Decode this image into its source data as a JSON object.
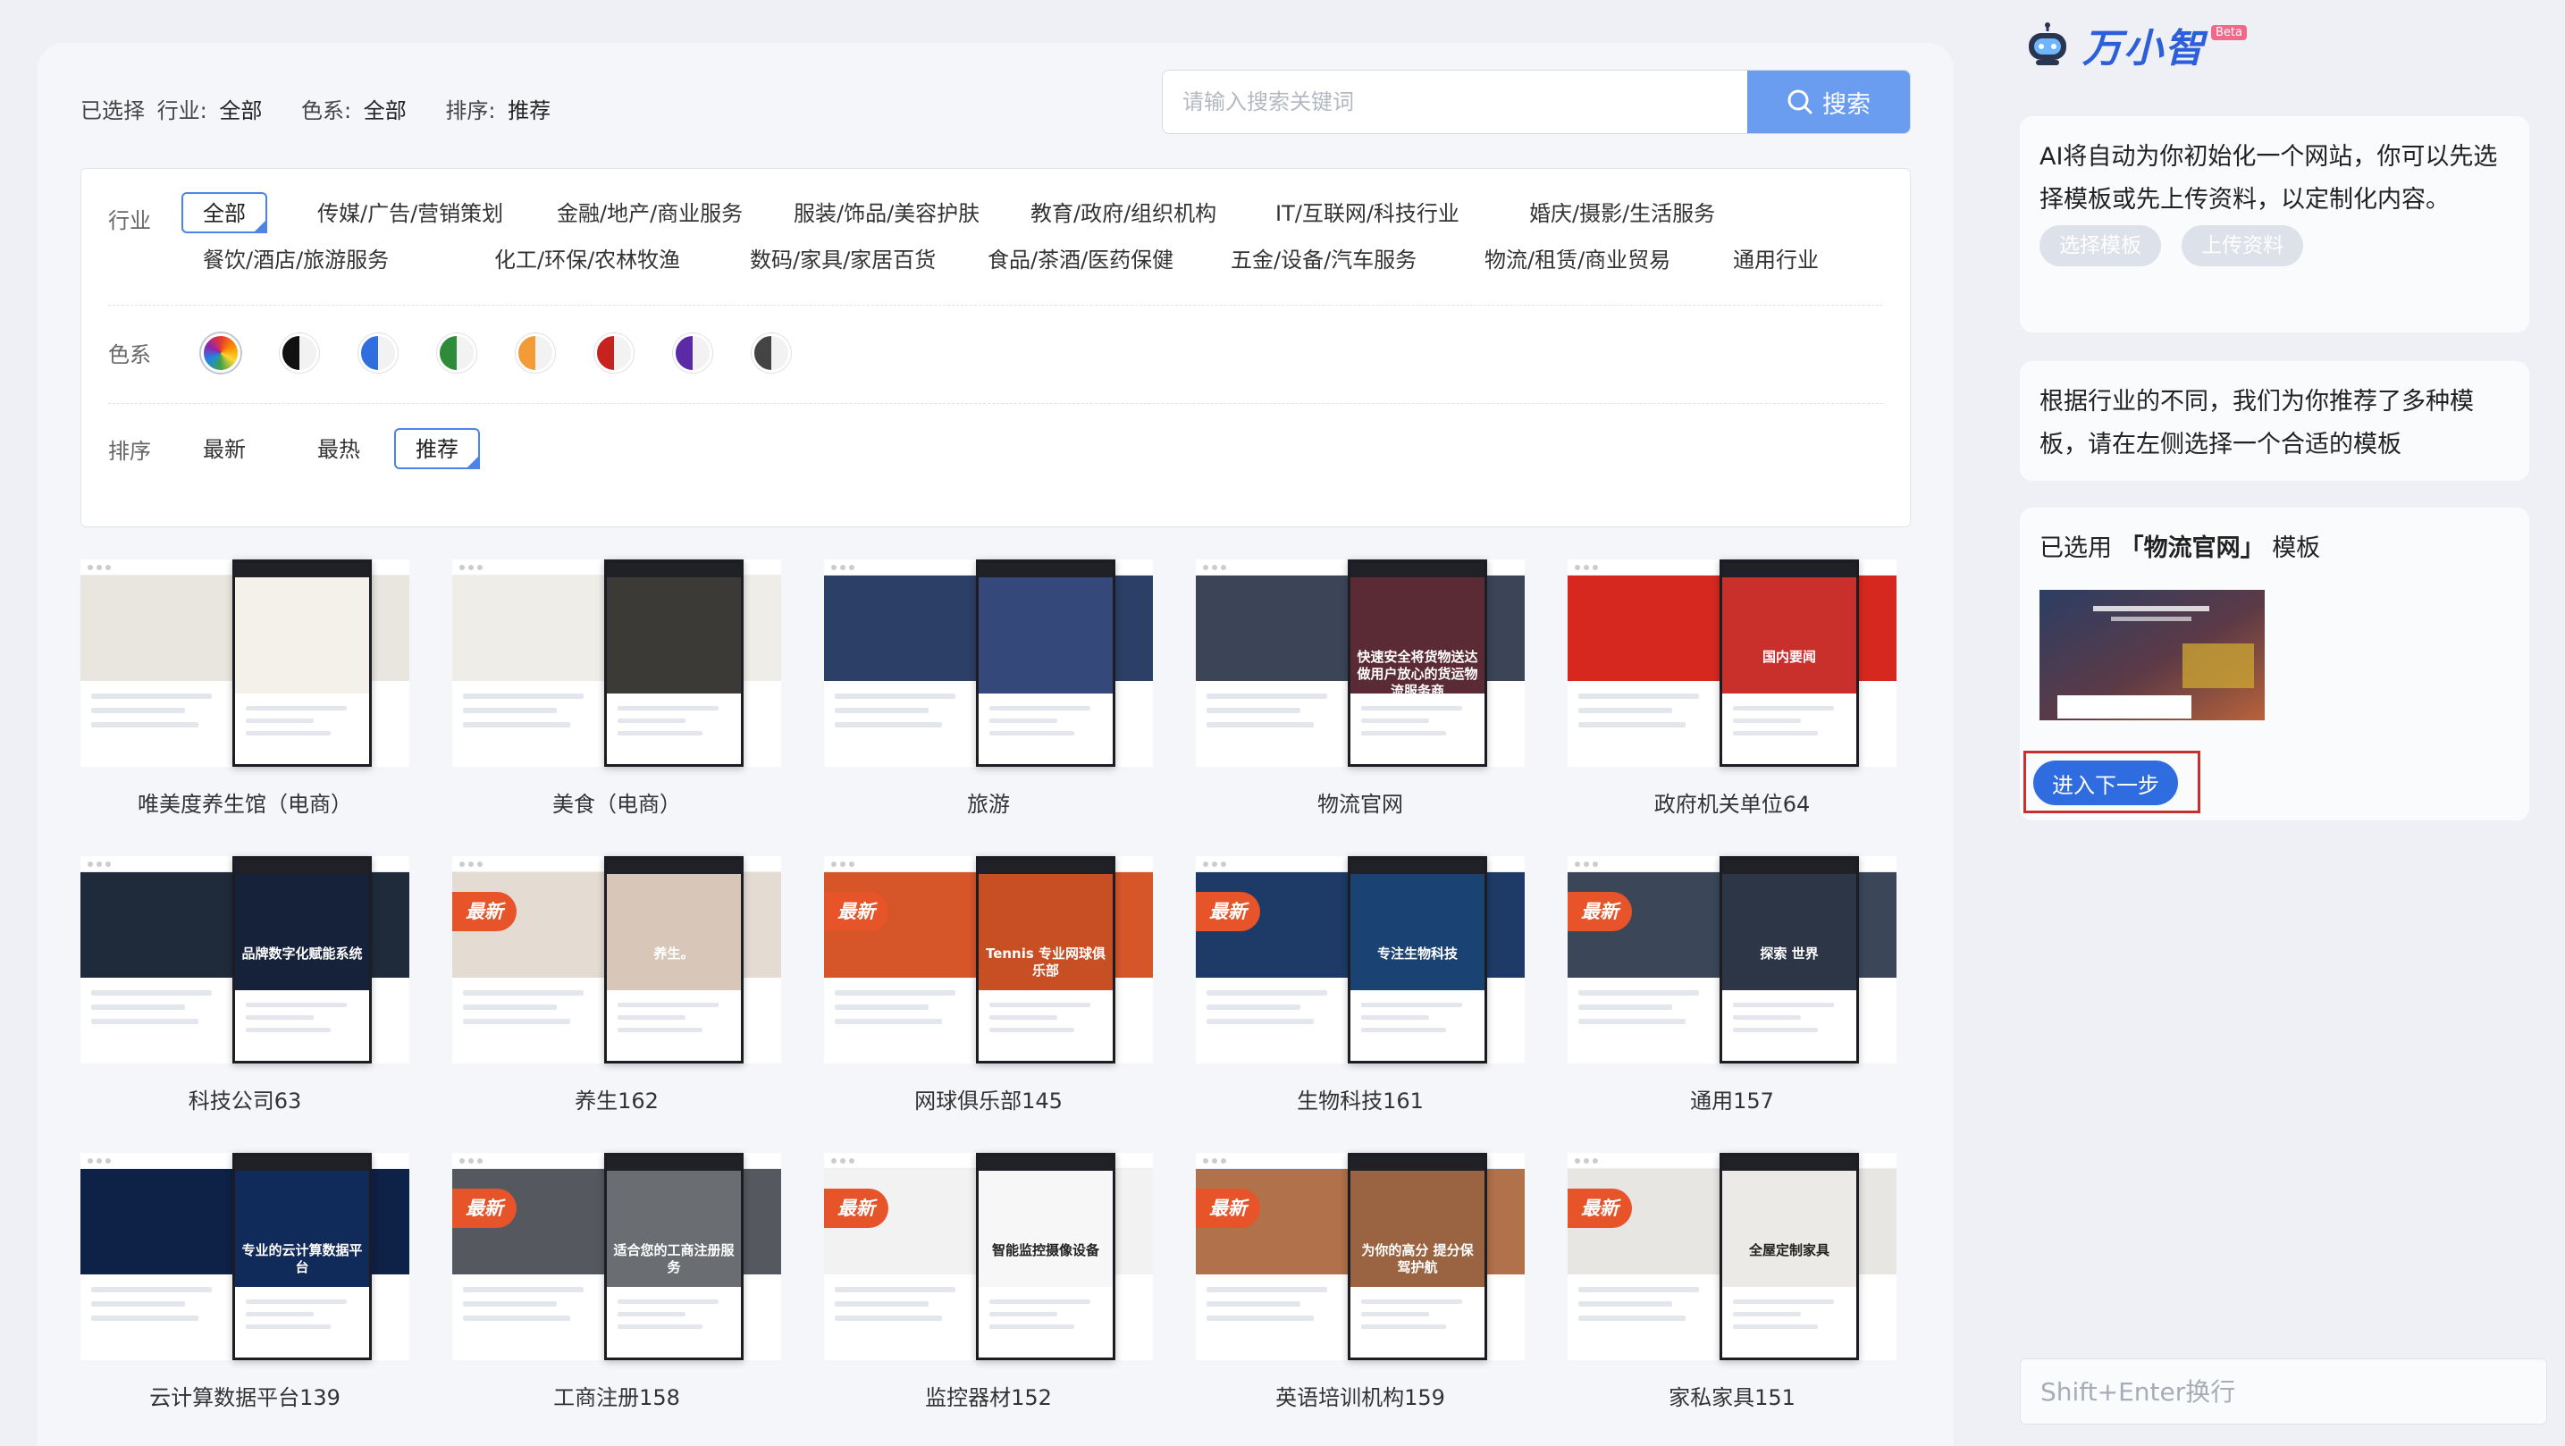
{
  "summary": {
    "prefix": "已选择",
    "industry_label": "行业:",
    "industry_value": "全部",
    "color_label": "色系:",
    "color_value": "全部",
    "sort_label": "排序:",
    "sort_value": "推荐"
  },
  "search": {
    "placeholder": "请输入搜索关键词",
    "button_label": "搜索"
  },
  "filters": {
    "industry_label": "行业",
    "industries_row1": [
      "全部",
      "传媒/广告/营销策划",
      "金融/地产/商业服务",
      "服装/饰品/美容护肤",
      "教育/政府/组织机构",
      "IT/互联网/科技行业",
      "婚庆/摄影/生活服务"
    ],
    "industries_row2": [
      "餐饮/酒店/旅游服务",
      "化工/环保/农林牧渔",
      "数码/家具/家居百货",
      "食品/茶酒/医药保健",
      "五金/设备/汽车服务",
      "物流/租赁/商业贸易",
      "通用行业"
    ],
    "color_label": "色系",
    "swatches": [
      "rainbow",
      "#111111",
      "#2f6fe0",
      "#2e8b3a",
      "#f29b38",
      "#c8221e",
      "#5b2aa7",
      "#444444"
    ],
    "sort_label": "排序",
    "sorts": [
      "最新",
      "最热",
      "推荐"
    ]
  },
  "new_tag": "最新",
  "templates": [
    {
      "name": "唯美度养生馆（电商）",
      "hero": "#e9e6df",
      "phone": "#f4f1ea",
      "ptext": "",
      "new": false
    },
    {
      "name": "美食（电商）",
      "hero": "#efede8",
      "phone": "#3b3a37",
      "ptext": "",
      "new": false
    },
    {
      "name": "旅游",
      "hero": "#2c3f66",
      "phone": "#34497a",
      "ptext": "",
      "new": false
    },
    {
      "name": "物流官网",
      "hero": "#3c4558",
      "phone": "#5a2a35",
      "ptext": "快速安全将货物送达 做用户放心的货运物流服务商",
      "new": false
    },
    {
      "name": "政府机关单位64",
      "hero": "#d6281f",
      "phone": "#c9302c",
      "ptext": "国内要闻",
      "new": false
    },
    {
      "name": "科技公司63",
      "hero": "#1f2a3b",
      "phone": "#15223a",
      "ptext": "品牌数字化赋能系统",
      "new": false
    },
    {
      "name": "养生162",
      "hero": "#e4dcd3",
      "phone": "#d8c7b9",
      "ptext": "养生。",
      "new": true
    },
    {
      "name": "网球俱乐部145",
      "hero": "#d6562a",
      "phone": "#c84e24",
      "ptext": "Tennis 专业网球俱乐部",
      "new": true
    },
    {
      "name": "生物科技161",
      "hero": "#1d3b66",
      "phone": "#1a4272",
      "ptext": "专注生物科技",
      "new": true
    },
    {
      "name": "通用157",
      "hero": "#3b4758",
      "phone": "#2c3646",
      "ptext": "探索 世界",
      "new": true
    },
    {
      "name": "云计算数据平台139",
      "hero": "#0e2146",
      "phone": "#102a5a",
      "ptext": "专业的云计算数据平台",
      "new": false
    },
    {
      "name": "工商注册158",
      "hero": "#55595f",
      "phone": "#6a6d72",
      "ptext": "适合您的工商注册服务",
      "new": true
    },
    {
      "name": "监控器材152",
      "hero": "#f2f2f2",
      "phone": "#f7f7f7",
      "ptext": "智能监控摄像设备",
      "new": true
    },
    {
      "name": "英语培训机构159",
      "hero": "#b1714a",
      "phone": "#9a6442",
      "ptext": "为你的高分 提分保驾护航",
      "new": true
    },
    {
      "name": "家私家具151",
      "hero": "#e8e6e2",
      "phone": "#eceae6",
      "ptext": "全屋定制家具",
      "new": true
    }
  ],
  "assistant": {
    "brand": "万小智",
    "beta": "Beta",
    "msg1": "AI将自动为你初始化一个网站，你可以先选择模板或先上传资料，以定制化内容。",
    "btn_choose": "选择模板",
    "btn_upload": "上传资料",
    "msg2": "根据行业的不同，我们为你推荐了多种模板，请在左侧选择一个合适的模板",
    "chosen_prefix": "已选用",
    "chosen_name": "「物流官网」",
    "chosen_suffix": "模板",
    "next_label": "进入下一步",
    "input_placeholder": "Shift+Enter换行"
  }
}
